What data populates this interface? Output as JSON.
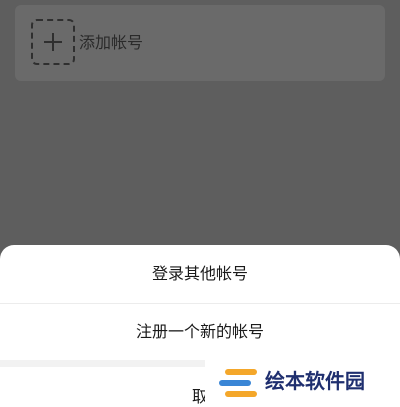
{
  "account_card": {
    "add_label": "添加帐号"
  },
  "action_sheet": {
    "items": [
      {
        "label": "登录其他帐号"
      },
      {
        "label": "注册一个新的帐号"
      }
    ],
    "cancel_label": "取"
  },
  "watermark": {
    "text": "绘本软件园",
    "colors": {
      "orange": "#f4a72a",
      "blue": "#3a86d6"
    }
  },
  "colors": {
    "overlay": "#5e5e5e",
    "card": "#6a6a6a",
    "sheet": "#ffffff"
  }
}
